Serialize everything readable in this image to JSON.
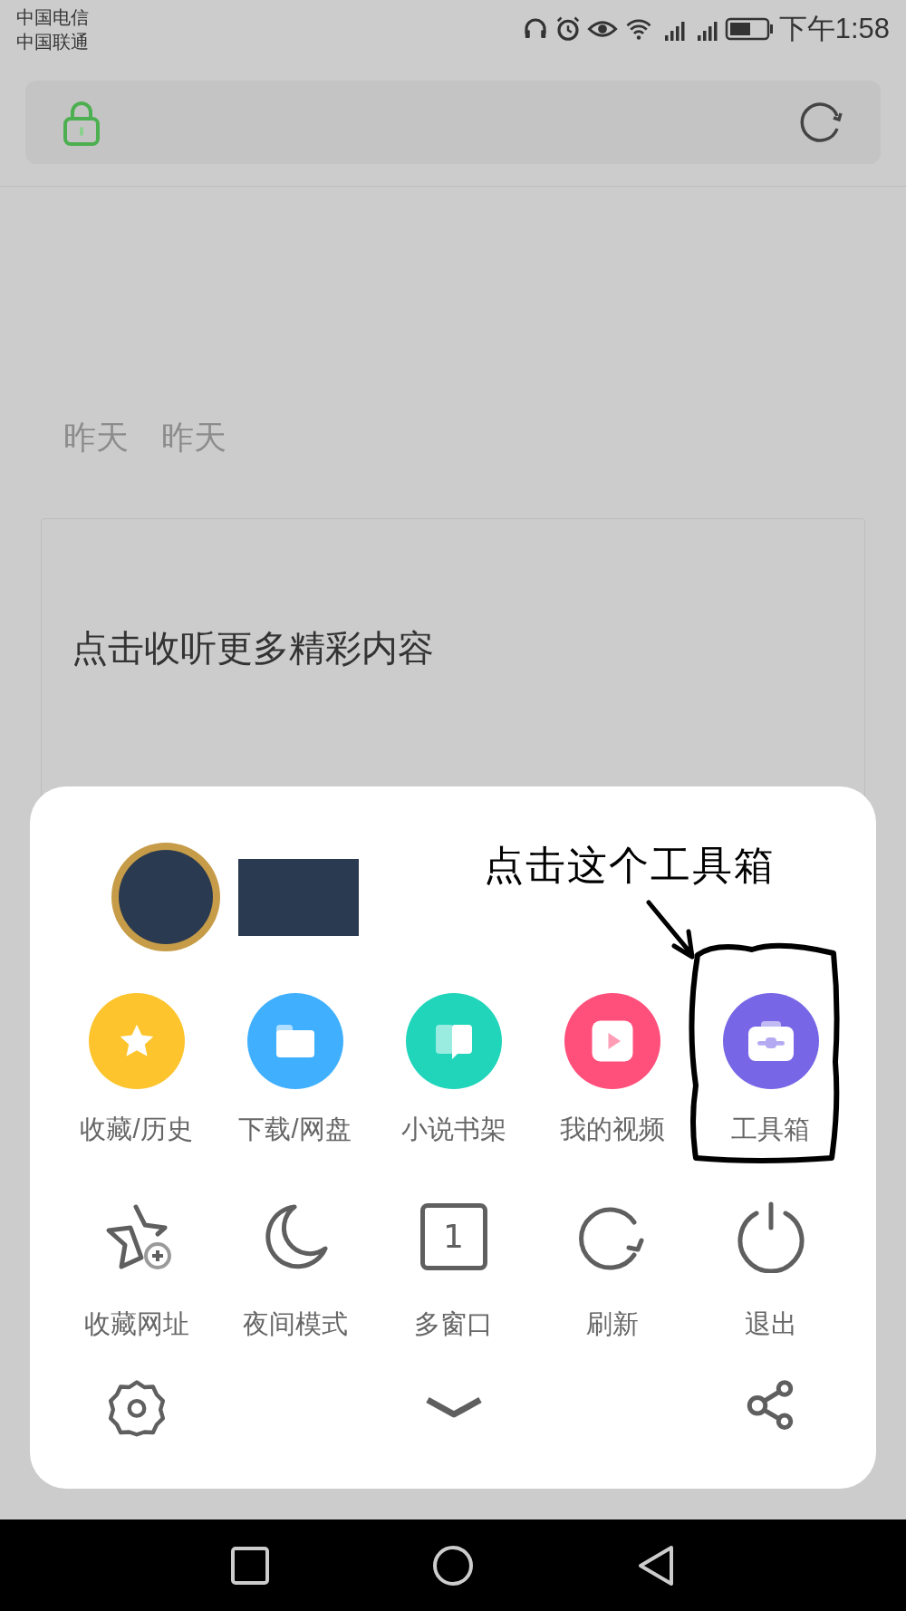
{
  "status_bar": {
    "carriers": [
      "中国电信",
      "中国联通"
    ],
    "time": "下午1:58"
  },
  "article": {
    "dates": [
      "昨天",
      "昨天"
    ]
  },
  "audio_card": {
    "prompt": "点击收听更多精彩内容"
  },
  "menu": {
    "annotation": "点击这个工具箱",
    "shortcuts": [
      {
        "label": "收藏/历史",
        "color": "#fdc42d"
      },
      {
        "label": "下载/网盘",
        "color": "#40b0fe"
      },
      {
        "label": "小说书架",
        "color": "#21d5bb"
      },
      {
        "label": "我的视频",
        "color": "#ff4f7b"
      },
      {
        "label": "工具箱",
        "color": "#7767e6"
      }
    ],
    "actions": [
      "收藏网址",
      "夜间模式",
      "多窗口",
      "刷新",
      "退出"
    ],
    "window_count": "1"
  }
}
